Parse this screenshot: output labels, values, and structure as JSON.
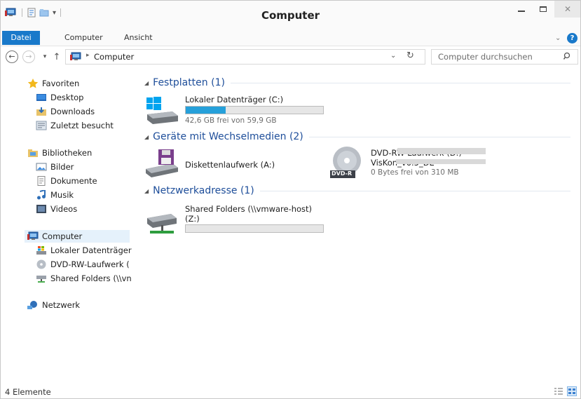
{
  "window": {
    "title": "Computer"
  },
  "ribbon": {
    "tabs": [
      "Datei",
      "Computer",
      "Ansicht"
    ]
  },
  "address": {
    "crumb": "Computer",
    "search_placeholder": "Computer durchsuchen"
  },
  "nav": {
    "favorites": {
      "header": "Favoriten",
      "items": [
        "Desktop",
        "Downloads",
        "Zuletzt besucht"
      ]
    },
    "libraries": {
      "header": "Bibliotheken",
      "items": [
        "Bilder",
        "Dokumente",
        "Musik",
        "Videos"
      ]
    },
    "computer": {
      "header": "Computer",
      "items": [
        "Lokaler Datenträger",
        "DVD-RW-Laufwerk (",
        "Shared Folders (\\\\vn"
      ]
    },
    "network": {
      "header": "Netzwerk"
    }
  },
  "groups": {
    "hard_drives": {
      "title": "Festplatten (1)",
      "drives": [
        {
          "name": "Lokaler Datenträger (C:)",
          "free_text": "42,6 GB frei von 59,9 GB",
          "used_fraction": 0.29
        }
      ]
    },
    "removable": {
      "title": "Geräte mit Wechselmedien (2)",
      "drives": [
        {
          "name": "Diskettenlaufwerk (A:)"
        },
        {
          "name": "DVD-RW-Laufwerk (D:)",
          "label_line": "VisKon_v6.5_DE",
          "free_text": "0 Bytes frei von 310 MB",
          "badge": "DVD-R"
        }
      ]
    },
    "network": {
      "title": "Netzwerkadresse (1)",
      "drives": [
        {
          "name": "Shared Folders (\\\\vmware-host)",
          "name_line2": "(Z:)",
          "used_fraction": 0
        }
      ]
    }
  },
  "status": {
    "count": "4 Elemente"
  },
  "colors": {
    "accent": "#1979ca",
    "group_title": "#1e4e9a",
    "bar_fill": "#26a0da"
  }
}
